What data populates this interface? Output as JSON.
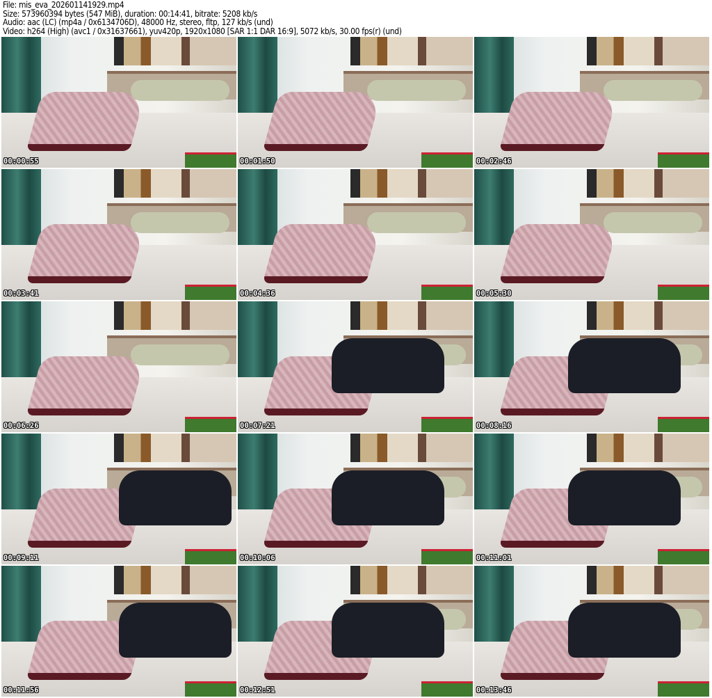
{
  "header": {
    "file": "File: mis_eva_202601141929.mp4",
    "size": "Size: 573960394 bytes (547 MiB), duration: 00:14:41, bitrate: 5208 kb/s",
    "audio": "Audio: aac (LC) (mp4a / 0x6134706D), 48000 Hz, stereo, fltp, 127 kb/s (und)",
    "video": "Video: h264 (High) (avc1 / 0x31637661), yuv420p, 1920x1080 [SAR 1:1 DAR 16:9], 5072 kb/s, 30.00 fps(r) (und)"
  },
  "thumbnails": [
    {
      "time": "00:00:55",
      "person": false
    },
    {
      "time": "00:01:50",
      "person": false
    },
    {
      "time": "00:02:46",
      "person": false
    },
    {
      "time": "00:03:41",
      "person": false
    },
    {
      "time": "00:04:36",
      "person": false
    },
    {
      "time": "00:05:30",
      "person": false
    },
    {
      "time": "00:06:26",
      "person": false
    },
    {
      "time": "00:07:21",
      "person": true
    },
    {
      "time": "00:08:16",
      "person": true
    },
    {
      "time": "00:09:11",
      "person": true
    },
    {
      "time": "00:10:06",
      "person": true
    },
    {
      "time": "00:11:01",
      "person": true
    },
    {
      "time": "00:11:56",
      "person": true
    },
    {
      "time": "00:12:51",
      "person": true
    },
    {
      "time": "00:13:46",
      "person": true
    }
  ]
}
